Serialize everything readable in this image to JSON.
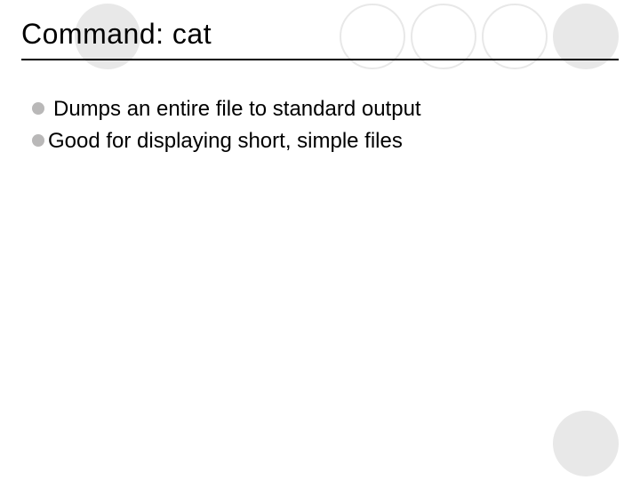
{
  "slide": {
    "title": "Command: cat",
    "bullets": [
      " Dumps an entire file to standard output",
      "Good for displaying short, simple files"
    ]
  }
}
